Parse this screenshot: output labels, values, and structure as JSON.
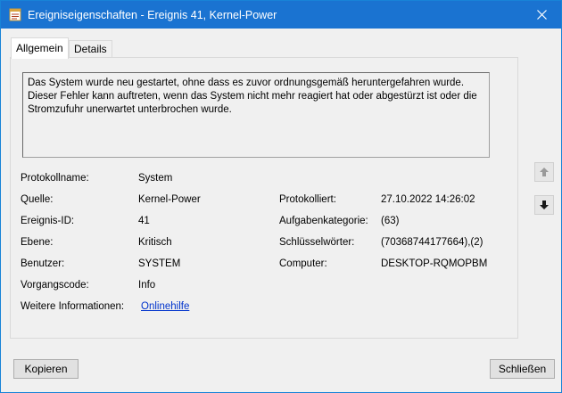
{
  "window": {
    "title": "Ereigniseigenschaften - Ereignis 41, Kernel-Power",
    "icons": {
      "app": "event-properties-icon",
      "close": "close-icon"
    }
  },
  "tabs": [
    {
      "label": "Allgemein",
      "active": true
    },
    {
      "label": "Details",
      "active": false
    }
  ],
  "description": {
    "lines": [
      "Das System wurde neu gestartet, ohne dass es zuvor ordnungsgemäß heruntergefahren wurde.",
      "Dieser Fehler kann auftreten, wenn das System nicht mehr reagiert hat oder abgestürzt ist oder die",
      "Stromzufuhr unerwartet unterbrochen wurde."
    ]
  },
  "fields": {
    "protokollname": {
      "label": "Protokollname:",
      "value": "System"
    },
    "quelle": {
      "label": "Quelle:",
      "value": "Kernel-Power"
    },
    "protokolliert": {
      "label": "Protokolliert:",
      "value": "27.10.2022 14:26:02"
    },
    "ereignis_id": {
      "label": "Ereignis-ID:",
      "value": "41"
    },
    "aufgabenkategorie": {
      "label": "Aufgabenkategorie:",
      "value": "(63)"
    },
    "ebene": {
      "label": "Ebene:",
      "value": "Kritisch"
    },
    "schluesselwoerter": {
      "label": "Schlüsselwörter:",
      "value": "(70368744177664),(2)"
    },
    "benutzer": {
      "label": "Benutzer:",
      "value": "SYSTEM"
    },
    "computer": {
      "label": "Computer:",
      "value": "DESKTOP-RQMOPBM"
    },
    "vorgangscode": {
      "label": "Vorgangscode:",
      "value": "Info"
    },
    "weitere_informationen": {
      "label": "Weitere Informationen:",
      "value": "Onlinehilfe"
    }
  },
  "nav": {
    "up_icon": "arrow-up-icon",
    "down_icon": "arrow-down-icon"
  },
  "buttons": {
    "copy": "Kopieren",
    "close": "Schließen"
  }
}
